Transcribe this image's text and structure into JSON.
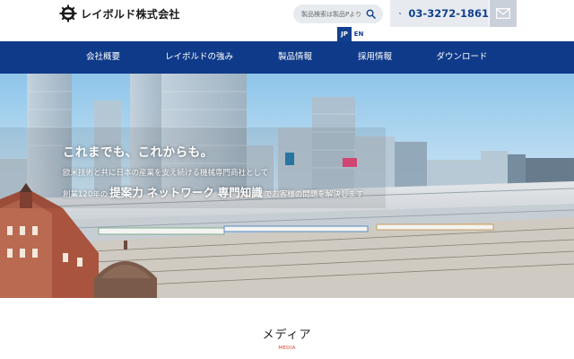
{
  "header": {
    "company_name": "レイボルド株式会社",
    "logo_icon": "gear-logo-icon",
    "search": {
      "placeholder": "製品検索は製品Pより"
    },
    "phone": {
      "number": "03-3272-1861",
      "icon": "phone-icon"
    },
    "mail_icon": "mail-icon",
    "languages": [
      "JP",
      "EN"
    ],
    "active_language": "JP"
  },
  "nav": {
    "items": [
      {
        "label": "会社概要"
      },
      {
        "label": "レイボルドの強み"
      },
      {
        "label": "製品情報"
      },
      {
        "label": "採用情報"
      },
      {
        "label": "ダウンロード"
      }
    ]
  },
  "hero": {
    "catch": "これまでも、これからも。",
    "line1": "欧米技術と共に日本の産業を支え続ける機械専門商社として",
    "line2_pre": "創業120年の",
    "line2_highlight1": "提案力",
    "line2_highlight2": "ネットワーク",
    "line2_highlight3": "専門知識",
    "line2_post": "でお客様の問題を解決します"
  },
  "media": {
    "title": "メディア",
    "subtitle": "MEDIA"
  },
  "colors": {
    "brand_navy": "#0f3a89",
    "phone_blue": "#123f8e",
    "accent_red": "#d7442e",
    "header_gray": "#e7ebf0"
  }
}
